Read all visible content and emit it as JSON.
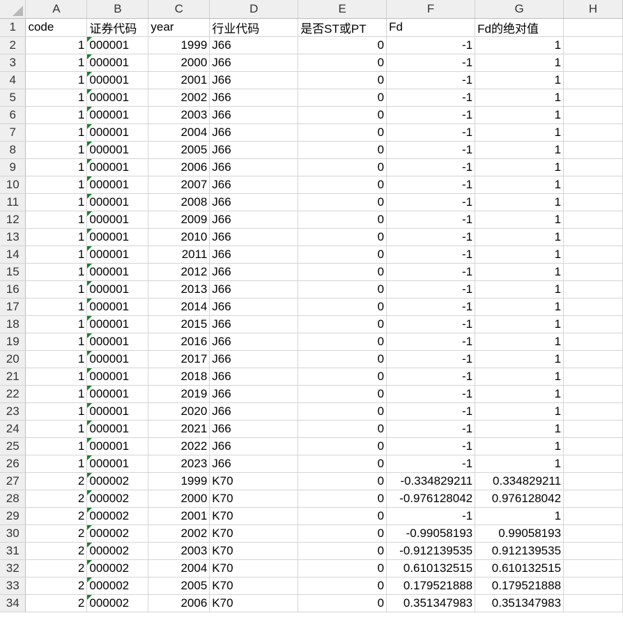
{
  "sheet": {
    "column_letters": [
      "A",
      "B",
      "C",
      "D",
      "E",
      "F",
      "G",
      "H"
    ],
    "rows": [
      {
        "n": "1",
        "code": "code",
        "sec": "证券代码",
        "year": "year",
        "ind": "行业代码",
        "st": "是否ST或PT",
        "fd": "Fd",
        "abs": "Fd的绝对值"
      },
      {
        "n": "2",
        "code": "1",
        "sec": "000001",
        "year": "1999",
        "ind": "J66",
        "st": "0",
        "fd": "-1",
        "abs": "1"
      },
      {
        "n": "3",
        "code": "1",
        "sec": "000001",
        "year": "2000",
        "ind": "J66",
        "st": "0",
        "fd": "-1",
        "abs": "1"
      },
      {
        "n": "4",
        "code": "1",
        "sec": "000001",
        "year": "2001",
        "ind": "J66",
        "st": "0",
        "fd": "-1",
        "abs": "1"
      },
      {
        "n": "5",
        "code": "1",
        "sec": "000001",
        "year": "2002",
        "ind": "J66",
        "st": "0",
        "fd": "-1",
        "abs": "1"
      },
      {
        "n": "6",
        "code": "1",
        "sec": "000001",
        "year": "2003",
        "ind": "J66",
        "st": "0",
        "fd": "-1",
        "abs": "1"
      },
      {
        "n": "7",
        "code": "1",
        "sec": "000001",
        "year": "2004",
        "ind": "J66",
        "st": "0",
        "fd": "-1",
        "abs": "1"
      },
      {
        "n": "8",
        "code": "1",
        "sec": "000001",
        "year": "2005",
        "ind": "J66",
        "st": "0",
        "fd": "-1",
        "abs": "1"
      },
      {
        "n": "9",
        "code": "1",
        "sec": "000001",
        "year": "2006",
        "ind": "J66",
        "st": "0",
        "fd": "-1",
        "abs": "1"
      },
      {
        "n": "10",
        "code": "1",
        "sec": "000001",
        "year": "2007",
        "ind": "J66",
        "st": "0",
        "fd": "-1",
        "abs": "1"
      },
      {
        "n": "11",
        "code": "1",
        "sec": "000001",
        "year": "2008",
        "ind": "J66",
        "st": "0",
        "fd": "-1",
        "abs": "1"
      },
      {
        "n": "12",
        "code": "1",
        "sec": "000001",
        "year": "2009",
        "ind": "J66",
        "st": "0",
        "fd": "-1",
        "abs": "1"
      },
      {
        "n": "13",
        "code": "1",
        "sec": "000001",
        "year": "2010",
        "ind": "J66",
        "st": "0",
        "fd": "-1",
        "abs": "1"
      },
      {
        "n": "14",
        "code": "1",
        "sec": "000001",
        "year": "2011",
        "ind": "J66",
        "st": "0",
        "fd": "-1",
        "abs": "1"
      },
      {
        "n": "15",
        "code": "1",
        "sec": "000001",
        "year": "2012",
        "ind": "J66",
        "st": "0",
        "fd": "-1",
        "abs": "1"
      },
      {
        "n": "16",
        "code": "1",
        "sec": "000001",
        "year": "2013",
        "ind": "J66",
        "st": "0",
        "fd": "-1",
        "abs": "1"
      },
      {
        "n": "17",
        "code": "1",
        "sec": "000001",
        "year": "2014",
        "ind": "J66",
        "st": "0",
        "fd": "-1",
        "abs": "1"
      },
      {
        "n": "18",
        "code": "1",
        "sec": "000001",
        "year": "2015",
        "ind": "J66",
        "st": "0",
        "fd": "-1",
        "abs": "1"
      },
      {
        "n": "19",
        "code": "1",
        "sec": "000001",
        "year": "2016",
        "ind": "J66",
        "st": "0",
        "fd": "-1",
        "abs": "1"
      },
      {
        "n": "20",
        "code": "1",
        "sec": "000001",
        "year": "2017",
        "ind": "J66",
        "st": "0",
        "fd": "-1",
        "abs": "1"
      },
      {
        "n": "21",
        "code": "1",
        "sec": "000001",
        "year": "2018",
        "ind": "J66",
        "st": "0",
        "fd": "-1",
        "abs": "1"
      },
      {
        "n": "22",
        "code": "1",
        "sec": "000001",
        "year": "2019",
        "ind": "J66",
        "st": "0",
        "fd": "-1",
        "abs": "1"
      },
      {
        "n": "23",
        "code": "1",
        "sec": "000001",
        "year": "2020",
        "ind": "J66",
        "st": "0",
        "fd": "-1",
        "abs": "1"
      },
      {
        "n": "24",
        "code": "1",
        "sec": "000001",
        "year": "2021",
        "ind": "J66",
        "st": "0",
        "fd": "-1",
        "abs": "1"
      },
      {
        "n": "25",
        "code": "1",
        "sec": "000001",
        "year": "2022",
        "ind": "J66",
        "st": "0",
        "fd": "-1",
        "abs": "1"
      },
      {
        "n": "26",
        "code": "1",
        "sec": "000001",
        "year": "2023",
        "ind": "J66",
        "st": "0",
        "fd": "-1",
        "abs": "1"
      },
      {
        "n": "27",
        "code": "2",
        "sec": "000002",
        "year": "1999",
        "ind": "K70",
        "st": "0",
        "fd": "-0.334829211",
        "abs": "0.334829211"
      },
      {
        "n": "28",
        "code": "2",
        "sec": "000002",
        "year": "2000",
        "ind": "K70",
        "st": "0",
        "fd": "-0.976128042",
        "abs": "0.976128042"
      },
      {
        "n": "29",
        "code": "2",
        "sec": "000002",
        "year": "2001",
        "ind": "K70",
        "st": "0",
        "fd": "-1",
        "abs": "1"
      },
      {
        "n": "30",
        "code": "2",
        "sec": "000002",
        "year": "2002",
        "ind": "K70",
        "st": "0",
        "fd": "-0.99058193",
        "abs": "0.99058193"
      },
      {
        "n": "31",
        "code": "2",
        "sec": "000002",
        "year": "2003",
        "ind": "K70",
        "st": "0",
        "fd": "-0.912139535",
        "abs": "0.912139535"
      },
      {
        "n": "32",
        "code": "2",
        "sec": "000002",
        "year": "2004",
        "ind": "K70",
        "st": "0",
        "fd": "0.610132515",
        "abs": "0.610132515"
      },
      {
        "n": "33",
        "code": "2",
        "sec": "000002",
        "year": "2005",
        "ind": "K70",
        "st": "0",
        "fd": "0.179521888",
        "abs": "0.179521888"
      },
      {
        "n": "34",
        "code": "2",
        "sec": "000002",
        "year": "2006",
        "ind": "K70",
        "st": "0",
        "fd": "0.351347983",
        "abs": "0.351347983"
      }
    ]
  }
}
